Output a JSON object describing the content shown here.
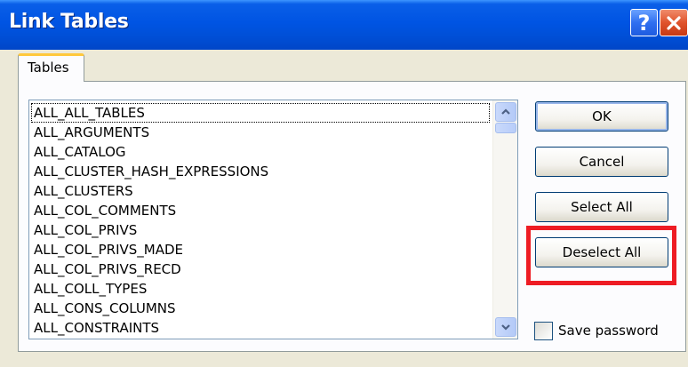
{
  "window": {
    "title": "Link Tables"
  },
  "titlebar": {
    "help_glyph": "?",
    "close_icon": "close-icon",
    "help_icon": "help-icon"
  },
  "tabs": [
    {
      "label": "Tables",
      "selected": true
    }
  ],
  "table_list": {
    "focused_index": 0,
    "items": [
      "ALL_ALL_TABLES",
      "ALL_ARGUMENTS",
      "ALL_CATALOG",
      "ALL_CLUSTER_HASH_EXPRESSIONS",
      "ALL_CLUSTERS",
      "ALL_COL_COMMENTS",
      "ALL_COL_PRIVS",
      "ALL_COL_PRIVS_MADE",
      "ALL_COL_PRIVS_RECD",
      "ALL_COLL_TYPES",
      "ALL_CONS_COLUMNS",
      "ALL_CONSTRAINTS"
    ]
  },
  "buttons": {
    "ok": "OK",
    "cancel": "Cancel",
    "select_all": "Select All",
    "deselect_all": "Deselect All"
  },
  "save_password": {
    "label": "Save password",
    "checked": false
  },
  "colors": {
    "titlebar": "#0054e3",
    "highlight": "#ee1c24",
    "tab_accent": "#ffc83c",
    "dialog_bg": "#ece9d8"
  }
}
